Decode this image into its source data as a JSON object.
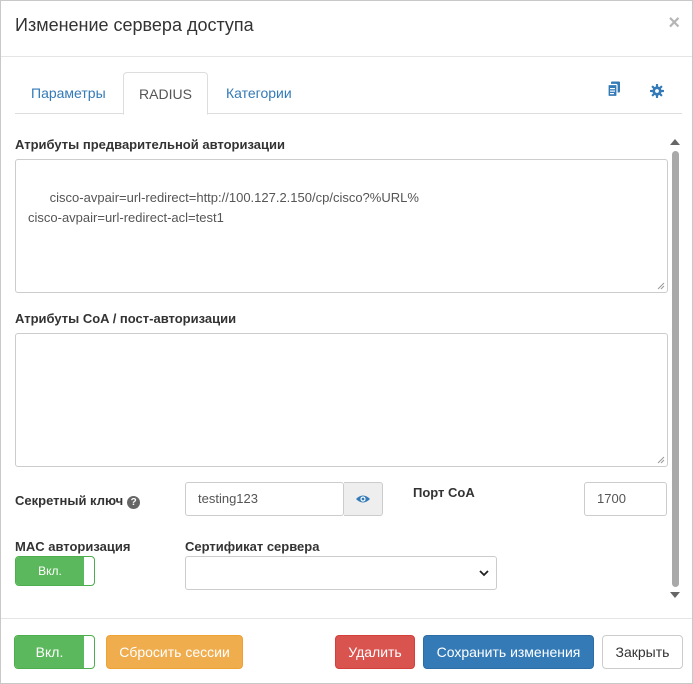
{
  "modal": {
    "title": "Изменение сервера доступа",
    "close_glyph": "×"
  },
  "tabs": [
    {
      "label": "Параметры",
      "active": false
    },
    {
      "label": "RADIUS",
      "active": true
    },
    {
      "label": "Категории",
      "active": false
    }
  ],
  "tab_tools": {
    "copy_icon": "copy-icon",
    "settings_icon": "gear-icon"
  },
  "form": {
    "preauth_label": "Атрибуты предварительной авторизации",
    "preauth_value": "cisco-avpair=url-redirect=http://100.127.2.150/cp/cisco?%URL%\ncisco-avpair=url-redirect-acl=test1",
    "coa_label": "Атрибуты CoA / пост-авторизации",
    "coa_value": "",
    "secret_label": "Секретный ключ",
    "secret_help_glyph": "?",
    "secret_value": "testing123",
    "secret_reveal_icon": "eye-icon",
    "coa_port_label": "Порт CoA",
    "coa_port_value": "1700",
    "mac_auth_label": "MAC авторизация",
    "mac_auth_toggle": "Вкл.",
    "cert_label": "Сертификат сервера",
    "cert_value": ""
  },
  "footer": {
    "enable_toggle": "Вкл.",
    "reset_sessions": "Сбросить сессии",
    "delete": "Удалить",
    "save": "Сохранить изменения",
    "close": "Закрыть"
  },
  "colors": {
    "primary": "#337ab7",
    "success": "#5cb85c",
    "warning": "#f0ad4e",
    "danger": "#d9534f"
  }
}
